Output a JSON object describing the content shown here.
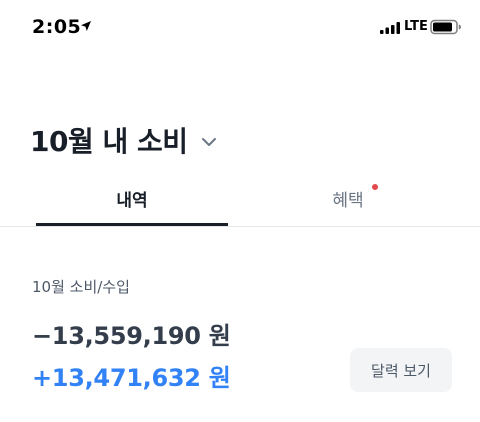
{
  "status_bar": {
    "time": "2:05",
    "network": "LTE"
  },
  "header": {
    "title": "10월 내 소비"
  },
  "tabs": [
    {
      "label": "내역",
      "active": true
    },
    {
      "label": "혜택",
      "active": false,
      "has_new_dot": true
    }
  ],
  "summary": {
    "label": "10월 소비/수입",
    "expense": "−13,559,190 원",
    "income": "+13,471,632 원",
    "calendar_button": "달력 보기"
  },
  "colors": {
    "text_primary": "#191f28",
    "income": "#3182f6",
    "badge_dot": "#e3494c",
    "button_bg": "#f2f4f6"
  },
  "icons": [
    "location-arrow-icon",
    "cellular-signal-icon",
    "battery-icon",
    "chevron-down-icon"
  ]
}
